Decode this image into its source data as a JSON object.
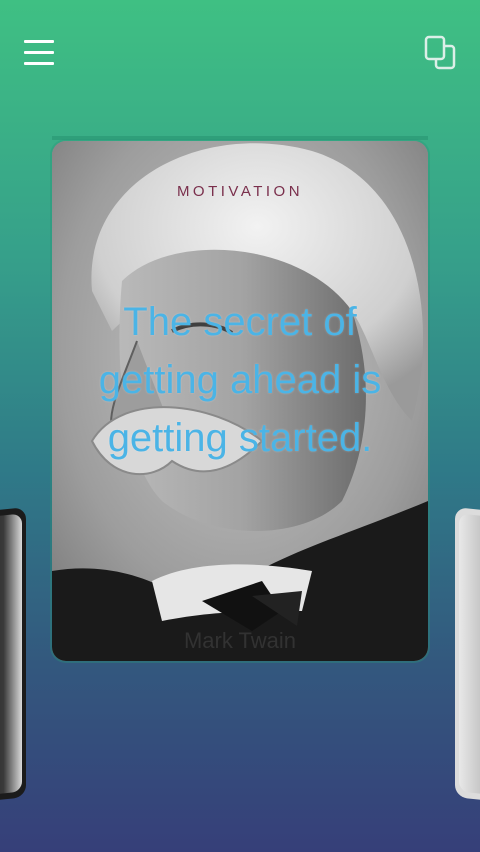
{
  "header": {
    "menu_icon": "hamburger-menu-icon",
    "copy_icon": "copy-icon"
  },
  "card": {
    "category": "MOTIVATION",
    "quote": "The secret of getting ahead is getting started.",
    "author": "Mark Twain"
  },
  "colors": {
    "background_top": "#3fc083",
    "background_bottom": "#363f79",
    "category_text": "#7a2f4c",
    "quote_text": "#4bb4e6"
  }
}
